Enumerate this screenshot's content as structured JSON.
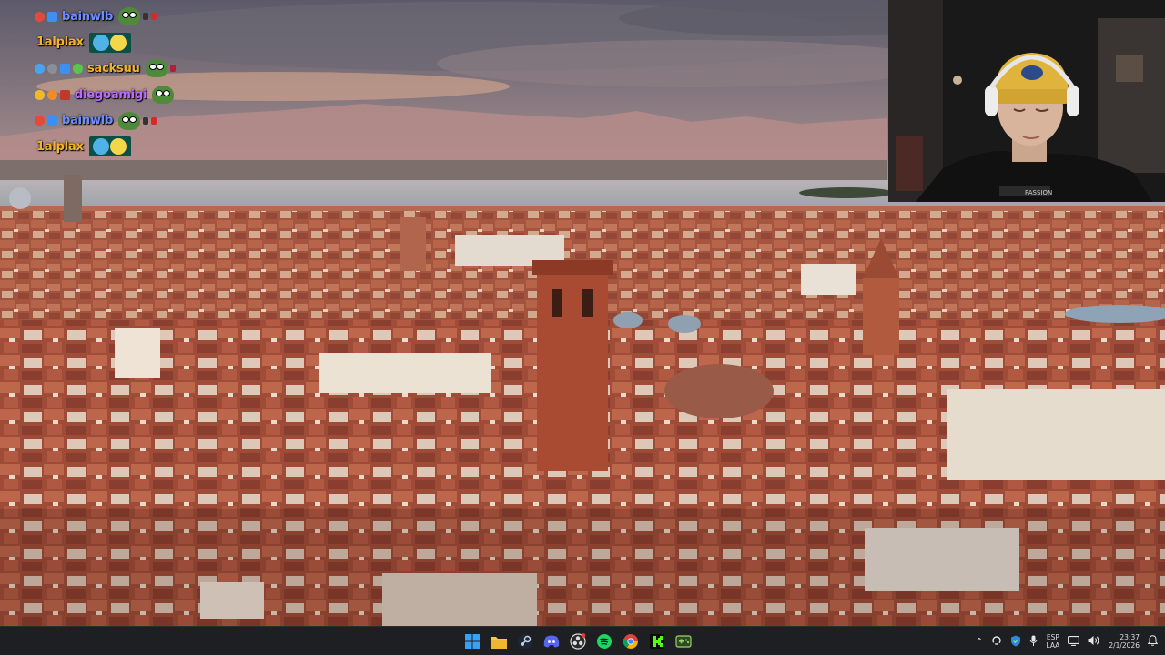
{
  "chat": {
    "messages": [
      {
        "username": "bainwlb",
        "color": "#6e8cff",
        "badges": [
          "red",
          "cube"
        ],
        "emotes": [
          "pepe",
          "tiny-dark",
          "tiny-red"
        ]
      },
      {
        "username": "1alplax",
        "color": "#f1b52c",
        "badges": [],
        "emotes": [
          "pair"
        ]
      },
      {
        "username": "sacksuu",
        "color": "#f0b42a",
        "badges": [
          "feather",
          "grey",
          "cube",
          "alien"
        ],
        "emotes": [
          "pepe",
          "tiny-wine"
        ]
      },
      {
        "username": "diegoamigi",
        "color": "#b96bff",
        "badges": [
          "gold",
          "coin",
          "mask"
        ],
        "emotes": [
          "pepe"
        ]
      },
      {
        "username": "bainwlb",
        "color": "#6e8cff",
        "badges": [
          "red",
          "cube"
        ],
        "emotes": [
          "pepe",
          "tiny-dark",
          "tiny-red"
        ]
      },
      {
        "username": "1alplax",
        "color": "#f1b52c",
        "badges": [],
        "emotes": [
          "pair"
        ]
      }
    ]
  },
  "webcam": {
    "subject": "streamer-with-yellow-beanie",
    "shirt_text": "PASSION"
  },
  "taskbar": {
    "apps": [
      {
        "name": "start-icon",
        "color": "#3a9cf0"
      },
      {
        "name": "file-explorer-icon",
        "color": "#f4c64a"
      },
      {
        "name": "steam-icon",
        "color": "#c7d5e0"
      },
      {
        "name": "discord-icon",
        "color": "#5865f2"
      },
      {
        "name": "obs-icon",
        "color": "#dcdcdc"
      },
      {
        "name": "spotify-icon",
        "color": "#1ed760"
      },
      {
        "name": "chrome-icon",
        "color": "#4285f4"
      },
      {
        "name": "kick-icon",
        "color": "#53fc18"
      },
      {
        "name": "controller-icon",
        "color": "#9ad36a"
      }
    ],
    "tray": {
      "language_line1": "ESP",
      "language_line2": "LAA",
      "time": "23:37",
      "date": "2/1/2026"
    }
  }
}
